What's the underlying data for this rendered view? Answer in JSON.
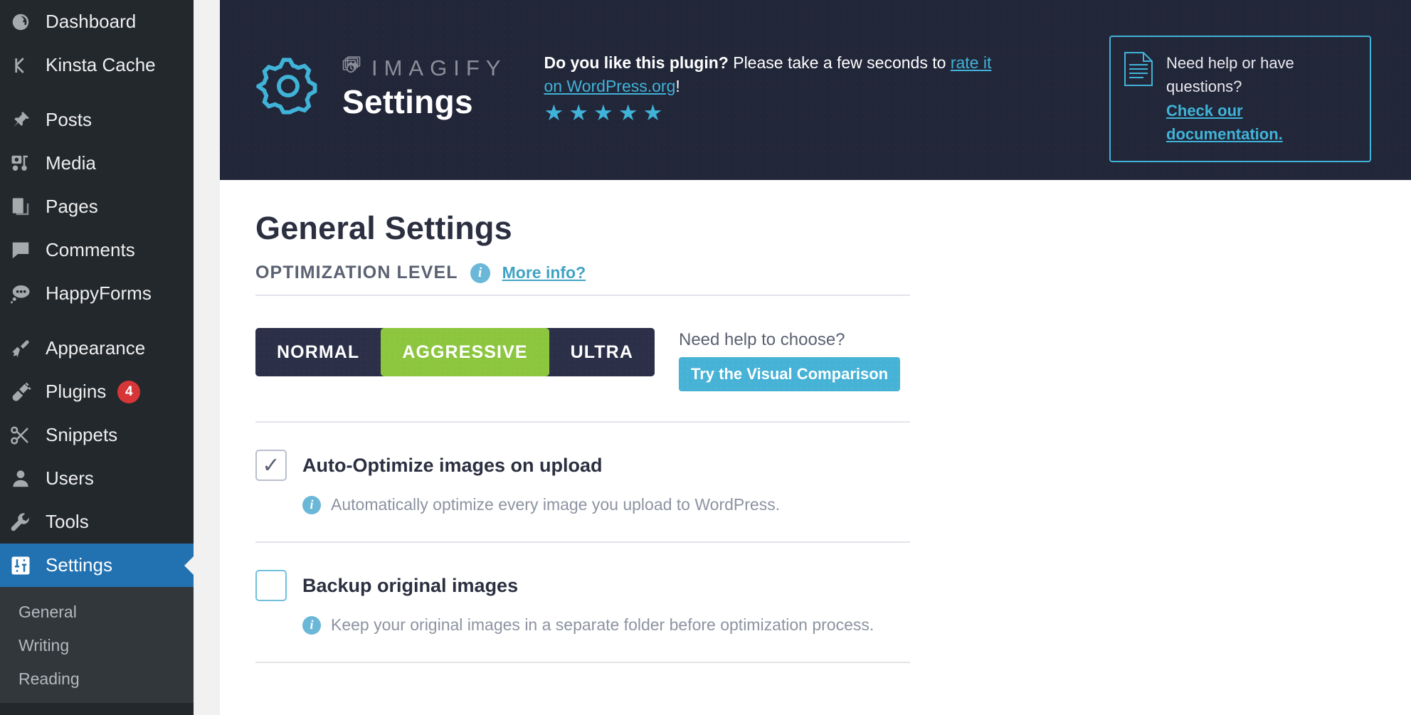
{
  "sidebar": {
    "items": [
      {
        "label": "Dashboard",
        "icon": "dashboard-icon",
        "active": false
      },
      {
        "label": "Kinsta Cache",
        "icon": "kinsta-k-icon",
        "active": false
      },
      {
        "label": "Posts",
        "icon": "pin-icon",
        "active": false
      },
      {
        "label": "Media",
        "icon": "media-icon",
        "active": false
      },
      {
        "label": "Pages",
        "icon": "pages-icon",
        "active": false
      },
      {
        "label": "Comments",
        "icon": "comment-bubble-icon",
        "active": false
      },
      {
        "label": "HappyForms",
        "icon": "happyforms-icon",
        "active": false
      },
      {
        "label": "Appearance",
        "icon": "paintbrush-icon",
        "active": false
      },
      {
        "label": "Plugins",
        "icon": "plug-icon",
        "badge": "4",
        "active": false
      },
      {
        "label": "Snippets",
        "icon": "scissors-icon",
        "active": false
      },
      {
        "label": "Users",
        "icon": "user-icon",
        "active": false
      },
      {
        "label": "Tools",
        "icon": "wrench-icon",
        "active": false
      },
      {
        "label": "Settings",
        "icon": "sliders-icon",
        "active": true
      }
    ],
    "submenu": [
      {
        "label": "General"
      },
      {
        "label": "Writing"
      },
      {
        "label": "Reading"
      }
    ]
  },
  "header": {
    "gear_icon": "gear-outline-icon",
    "brand_icon": "imagify-photos-icon",
    "brand_word": "IMAGIFY",
    "page_kicker": "Settings",
    "rate": {
      "bold_part": "Do you like this plugin?",
      "rest_part": " Please take a few seconds to ",
      "link": "rate it on WordPress.org",
      "suffix": "!",
      "stars": "★★★★★",
      "star_count": 5
    },
    "help": {
      "icon": "document-lines-icon",
      "line1": "Need help or have",
      "line2": "questions?",
      "link1": "Check our",
      "link2": "documentation."
    }
  },
  "main": {
    "page_title": "General Settings",
    "optimization": {
      "section_title": "OPTIMIZATION LEVEL",
      "info_icon": "info-icon",
      "more_info_label": "More info?",
      "levels": [
        {
          "label": "NORMAL",
          "selected": false
        },
        {
          "label": "AGGRESSIVE",
          "selected": true
        },
        {
          "label": "ULTRA",
          "selected": false
        }
      ],
      "selected_level": "AGGRESSIVE",
      "help_label": "Need help to choose?",
      "compare_button": "Try the Visual Comparison"
    },
    "options": [
      {
        "label": "Auto-Optimize images on upload",
        "checked": true,
        "check_glyph": "✓",
        "description": "Automatically optimize every image you upload to WordPress.",
        "info_icon": "info-icon"
      },
      {
        "label": "Backup original images",
        "checked": false,
        "check_glyph": "",
        "description": "Keep your original images in a separate folder before optimization process.",
        "info_icon": "info-icon"
      }
    ]
  },
  "colors": {
    "header_bg": "#222639",
    "accent_blue": "#40b3d8",
    "accent_green": "#8cc63e",
    "wp_admin_blue": "#2271b1",
    "sidebar_bg": "#23282d",
    "badge_red": "#d63638"
  }
}
